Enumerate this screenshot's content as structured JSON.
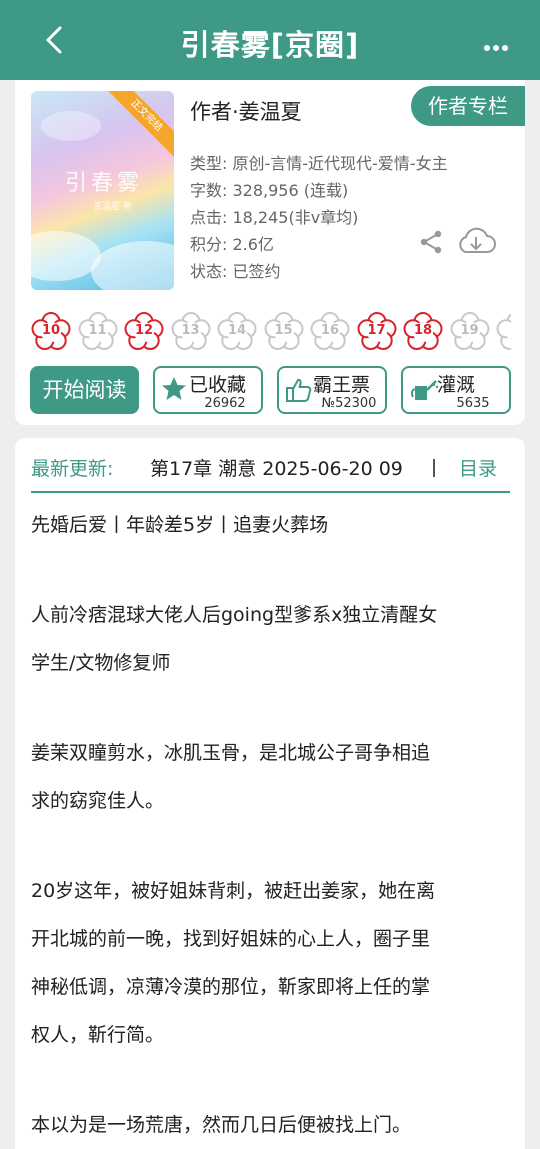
{
  "header": {
    "title": "引春雾[京圈]",
    "back_icon": "chevron-left-icon",
    "more_icon": "more-dots-icon"
  },
  "book": {
    "cover_title": "引春雾",
    "cover_subtitle": "姜温夏 著",
    "cover_badge": "正文完结",
    "author": "作者·姜温夏",
    "author_column_button": "作者专栏",
    "type": "类型: 原创-言情-近代现代-爱情-女主",
    "words": "字数: 328,956 (连载)",
    "clicks": "点击: 18,245(非v章均)",
    "score": "积分: 2.6亿",
    "status": "状态: 已签约"
  },
  "flowers": [
    {
      "label": "10",
      "active": true
    },
    {
      "label": "11",
      "active": false
    },
    {
      "label": "12",
      "active": true
    },
    {
      "label": "13",
      "active": false
    },
    {
      "label": "14",
      "active": false
    },
    {
      "label": "15",
      "active": false
    },
    {
      "label": "16",
      "active": false
    },
    {
      "label": "17",
      "active": true
    },
    {
      "label": "18",
      "active": true
    },
    {
      "label": "19",
      "active": false
    },
    {
      "label": "",
      "active": false
    }
  ],
  "actions": {
    "read": "开始阅读",
    "favorite": {
      "label": "已收藏",
      "count": "26962"
    },
    "ticket": {
      "label": "霸王票",
      "count": "№52300"
    },
    "water": {
      "label": "灌溉",
      "count": "5635"
    }
  },
  "update": {
    "label": "最新更新:",
    "text": "第17章  潮意  2025-06-20 09",
    "toc": "目录"
  },
  "intro": {
    "l1": "先婚后爱丨年龄差5岁丨追妻火葬场",
    "l2": "人前冷痞混球大佬人后going型爹系x独立清醒女",
    "l3": "学生/文物修复师",
    "l4": "姜茉双瞳剪水，冰肌玉骨，是北城公子哥争相追",
    "l5": "求的窈窕佳人。",
    "l6": "20岁这年，被好姐妹背刺，被赶出姜家，她在离",
    "l7": "开北城的前一晚，找到好姐妹的心上人，圈子里",
    "l8": "神秘低调，凉薄冷漠的那位，靳家即将上任的掌",
    "l9": "权人，靳行简。",
    "l10": "本以为是一场荒唐，然而几日后便被找上门。"
  },
  "colors": {
    "accent": "#3e9a86",
    "flower_active": "#d9222a",
    "flower_inactive": "#c8c8c8"
  }
}
